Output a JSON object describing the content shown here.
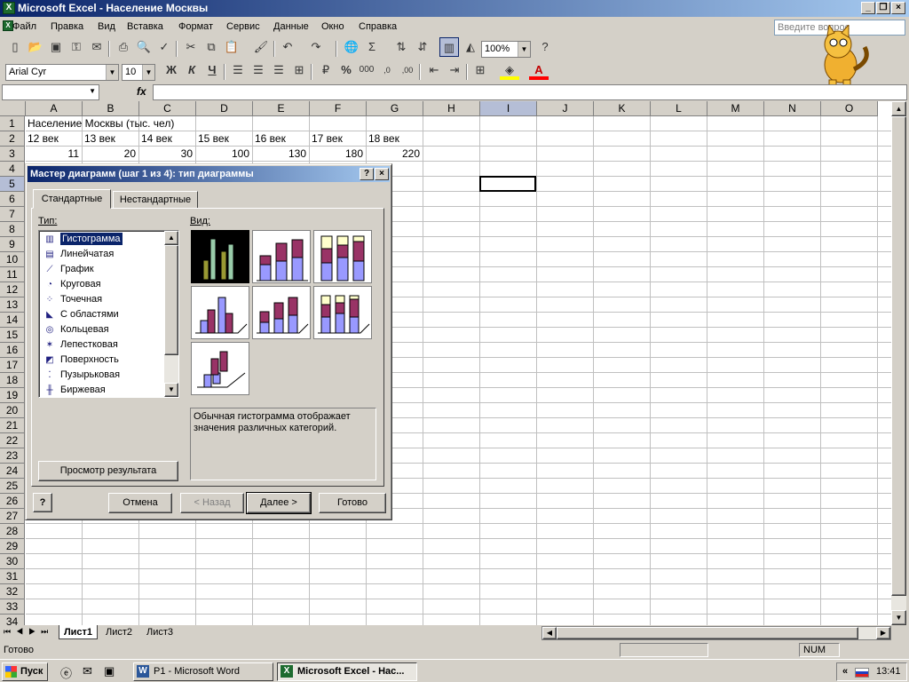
{
  "window": {
    "title": "Microsoft Excel - Население Москвы"
  },
  "menu": [
    "Файл",
    "Правка",
    "Вид",
    "Вставка",
    "Формат",
    "Сервис",
    "Данные",
    "Окно",
    "Справка"
  ],
  "ask_placeholder": "Введите вопрос",
  "toolbar": {
    "zoom": "100%",
    "font": "Arial Cyr",
    "size": "10",
    "bold": "Ж",
    "italic": "К",
    "underline": "Ч",
    "percent": "%",
    "thousands": "000"
  },
  "columns": [
    "A",
    "B",
    "C",
    "D",
    "E",
    "F",
    "G",
    "H",
    "I",
    "J",
    "K",
    "L",
    "M",
    "N",
    "O"
  ],
  "rows": [
    "1",
    "2",
    "3",
    "4",
    "5",
    "6",
    "7",
    "8",
    "9",
    "10",
    "11",
    "12",
    "13",
    "14",
    "15",
    "16",
    "17",
    "18",
    "19",
    "20",
    "21",
    "22",
    "23",
    "24",
    "25",
    "26",
    "27",
    "28",
    "29",
    "30",
    "31",
    "32",
    "33",
    "34"
  ],
  "cells": {
    "a1": "Население Москвы (тыс. чел)",
    "row2": [
      "12 век",
      "13 век",
      "14 век",
      "15 век",
      "16 век",
      "17 век",
      "18 век"
    ],
    "row3": [
      "11",
      "20",
      "30",
      "100",
      "130",
      "180",
      "220"
    ]
  },
  "dialog": {
    "title": "Мастер диаграмм (шаг 1 из 4): тип диаграммы",
    "help": "?",
    "close": "×",
    "tab_standard": "Стандартные",
    "tab_custom": "Нестандартные",
    "type_label": "Тип:",
    "view_label": "Вид:",
    "types": [
      "Гистограмма",
      "Линейчатая",
      "График",
      "Круговая",
      "Точечная",
      "С областями",
      "Кольцевая",
      "Лепестковая",
      "Поверхность",
      "Пузырьковая",
      "Биржевая"
    ],
    "description": "Обычная гистограмма отображает значения различных категорий.",
    "preview_btn": "Просмотр результата",
    "cancel": "Отмена",
    "back": "< Назад",
    "next": "Далее >",
    "finish": "Готово"
  },
  "sheets": [
    "Лист1",
    "Лист2",
    "Лист3"
  ],
  "status": {
    "left": "Готово",
    "num": "NUM"
  },
  "taskbar": {
    "start": "Пуск",
    "word": "P1 - Microsoft Word",
    "excel": "Microsoft Excel - Нас...",
    "clock": "13:41",
    "tray_arrows": "«"
  }
}
